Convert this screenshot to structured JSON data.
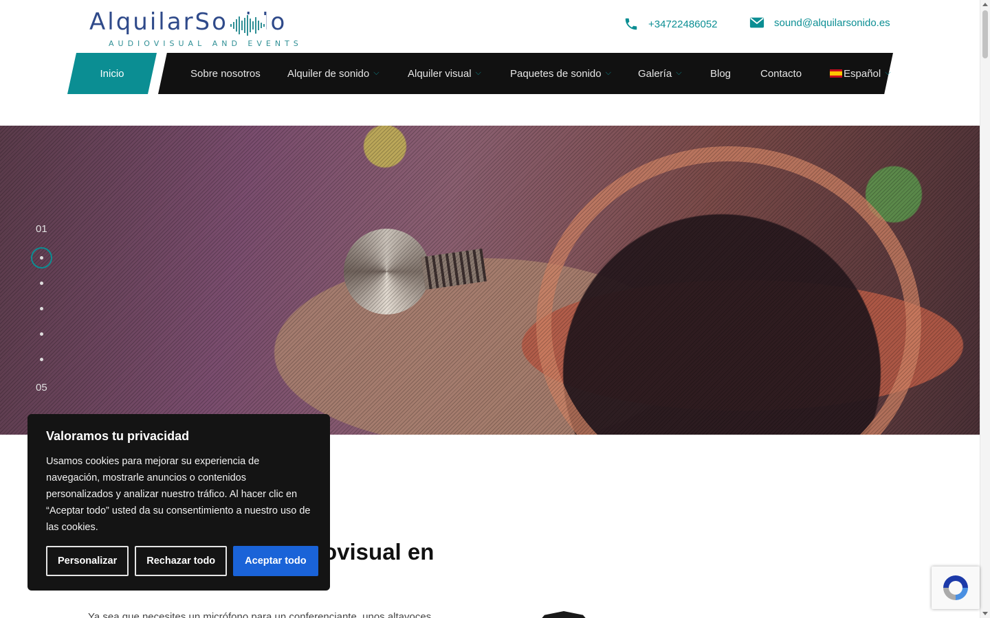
{
  "brand": {
    "logo_name": "AlquilarSonido",
    "logo_tagline": "AUDIOVISUAL AND EVENTS"
  },
  "contact": {
    "phone": "+34722486052",
    "email": "sound@alquilarsonido.es"
  },
  "nav": {
    "home": "Inicio",
    "items": [
      {
        "label": "Sobre nosotros"
      },
      {
        "label": "Alquiler de sonido"
      },
      {
        "label": "Alquiler visual"
      },
      {
        "label": "Paquetes de sonido"
      },
      {
        "label": "Galería"
      },
      {
        "label": "Blog"
      },
      {
        "label": "Contacto"
      },
      {
        "label": "Español"
      }
    ]
  },
  "slider": {
    "first": "01",
    "last": "05",
    "current_slide": 1,
    "total_slides": 5
  },
  "content": {
    "heading_partial": "ovisual en",
    "body_partial": "Ya sea que necesites un micrófono para un conferenciante, unos altavoces"
  },
  "cookie": {
    "title": "Valoramos tu privacidad",
    "text": "Usamos cookies para mejorar su experiencia de navegación, mostrarle anuncios o contenidos personalizados y analizar nuestro tráfico. Al hacer clic en “Aceptar todo” usted da su consentimiento a nuestro uso de las cookies.",
    "btn_customize": "Personalizar",
    "btn_reject": "Rechazar todo",
    "btn_accept": "Aceptar todo"
  },
  "colors": {
    "accent": "#0b8e93",
    "nav_bg": "#111111",
    "accept_button": "#1a63d8",
    "logo_blue": "#2f4a8a"
  },
  "icons": [
    "phone-icon",
    "envelope-icon",
    "chevron-down-icon",
    "spain-flag-icon",
    "recaptcha-icon"
  ]
}
